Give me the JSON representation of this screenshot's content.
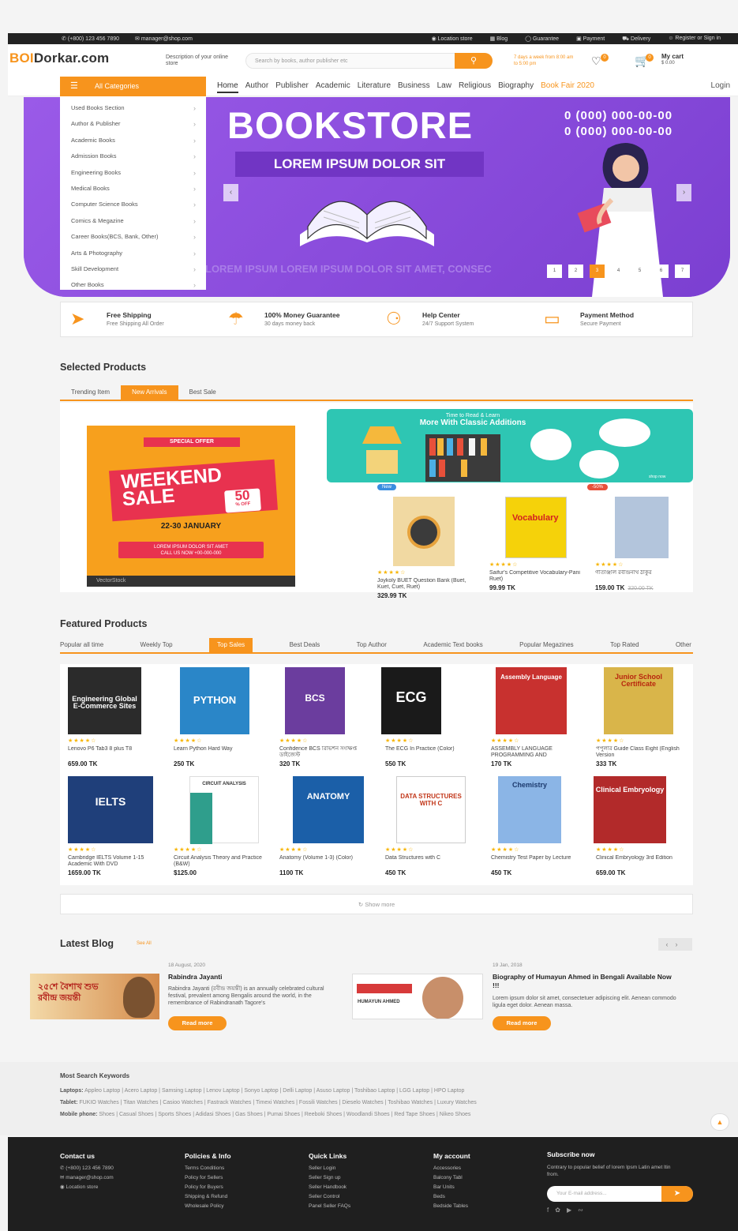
{
  "topbar": {
    "phone": "(+800) 123 456 7890",
    "email": "manager@shop.com",
    "links": [
      "Location store",
      "Blog",
      "Guarantee",
      "Payment",
      "Delivery",
      "Register or Sign in"
    ]
  },
  "header": {
    "logo_a": "BOI",
    "logo_b": "Dorkar.com",
    "desc": "Description of your online store",
    "search_placeholder": "Search by books, author publisher etc",
    "hours": "7 days a week from 8:00 am to 5:00 pm",
    "wish_count": "0",
    "cart_count": "0",
    "cart_label": "My cart",
    "cart_value": "$ 0.00"
  },
  "nav": {
    "all_categories": "All Categories",
    "menu": [
      "Home",
      "Author",
      "Publisher",
      "Academic",
      "Literature",
      "Business",
      "Law",
      "Religious",
      "Biography",
      "Book Fair 2020"
    ],
    "login": "Login"
  },
  "categories": [
    "Used Books Section",
    "Author & Publisher",
    "Academic Books",
    "Admission Books",
    "Engineering Books",
    "Medical Books",
    "Computer Science Books",
    "Comics & Megazine",
    "Career Books(BCS, Bank, Other)",
    "Arts & Photography",
    "Skill Development",
    "Other Books"
  ],
  "banner": {
    "title": "BOOKSTORE",
    "subtitle": "LOREM IPSUM DOLOR SIT",
    "phone1": "0 (000) 000-00-00",
    "phone2": "0 (000) 000-00-00",
    "bottom": "LOREM IPSUM LOREM IPSUM DOLOR SIT AMET, CONSEC",
    "pages": [
      "1",
      "2",
      "3",
      "4",
      "5",
      "6",
      "7"
    ],
    "active_page": "3"
  },
  "features": [
    {
      "title": "Free Shipping",
      "sub": "Free Shipping All Order",
      "icon": "rocket-icon"
    },
    {
      "title": "100% Money Guarantee",
      "sub": "30 days money back",
      "icon": "umbrella-icon"
    },
    {
      "title": "Help Center",
      "sub": "24/7 Support System",
      "icon": "support-24-icon"
    },
    {
      "title": "Payment Method",
      "sub": "Secure Payment",
      "icon": "card-icon"
    }
  ],
  "selected": {
    "heading": "Selected Products",
    "tabs": [
      "Trending Item",
      "New Arrivals",
      "Best Sale"
    ],
    "active_tab": "New Arrivals",
    "weekend": {
      "special": "SPECIAL OFFER",
      "l1": "WEEKEND",
      "l2": "SALE",
      "pct": "50",
      "off": "% OFF",
      "date": "22-30 JANUARY",
      "call1": "LOREM IPSUM DOLOR SIT AMET",
      "call2": "CALL US NOW +00-000-000",
      "foot": "VectorStock"
    },
    "classic": {
      "l1": "Time to Read & Learn",
      "l2": "More With Classic Additions",
      "more": "shop now"
    },
    "products": [
      {
        "tag": "New",
        "title": "Joykoly BUET Question Bank (Buet, Kuet, Cuet, Ruet)",
        "price": "329.99 TK",
        "old": ""
      },
      {
        "tag": "",
        "title": "Saifur's Competitive Vocabulary-Pani Ruet)",
        "price": "99.99 TK",
        "old": ""
      },
      {
        "tag": "-50%",
        "title": "গীতাঞ্জলি রবীন্দ্রনাথ ঠাকুর",
        "price": "159.00 TK",
        "old": "320.00 TK"
      }
    ]
  },
  "featured": {
    "heading": "Featured Products",
    "tabs": [
      "Popular all time",
      "Weekly Top",
      "Top Sales",
      "Best Deals",
      "Top Author",
      "Academic Text books",
      "Popular Megazines",
      "Top Rated",
      "Other"
    ],
    "active_tab": "Top Sales",
    "products": [
      {
        "title": "Lenovo P6 Tab3 8 plus T8",
        "price": "659.00 TK",
        "cover": "Engineering Global E-Commerce Sites",
        "color": "#2b2b2b"
      },
      {
        "title": "Learn Python Hard Way",
        "price": "250 TK",
        "cover": "PYTHON",
        "color": "#2a86c8"
      },
      {
        "title": "Confidence BCS রিভিশন সংক্ষিপ্ত ডাইজেস্ট",
        "price": "320 TK",
        "cover": "BCS",
        "color": "#6b3d9e"
      },
      {
        "title": "The ECG In Practice (Color)",
        "price": "550 TK",
        "cover": "ECG",
        "color": "#1a1a1a"
      },
      {
        "title": "ASSEMBLY LANGUAGE PROGRAMMING AND",
        "price": "170 TK",
        "cover": "Assembly Language",
        "color": "#c8312f"
      },
      {
        "title": "পপুলার Guide Class Eight (English Version",
        "price": "333 TK",
        "cover": "Junior School Certificate",
        "color": "#d9b54a"
      },
      {
        "title": "Cambridge IELTS Volume 1-15 Academic With DVD",
        "price": "1659.00 TK",
        "cover": "IELTS",
        "color": "#1f3f7a"
      },
      {
        "title": "Circuit Analysis Theory and Practice (B&W)",
        "price": "$125.00",
        "cover": "CIRCUIT ANALYSIS",
        "color": "#2f9e8c"
      },
      {
        "title": "Anatomy (Volume 1-3) (Color)",
        "price": "1100 TK",
        "cover": "ANATOMY",
        "color": "#1b5fa8"
      },
      {
        "title": "Data Structures with C",
        "price": "450 TK",
        "cover": "DATA STRUCTURES WITH C",
        "color": "#e26a2c"
      },
      {
        "title": "Chemistry Test Paper by Lecture",
        "price": "450 TK",
        "cover": "Chemistry",
        "color": "#8bb5e6"
      },
      {
        "title": "Clinical Embryology 3rd Edition",
        "price": "659.00 TK",
        "cover": "Clinical Embryology",
        "color": "#b22a2a"
      }
    ],
    "show_more": "Show more"
  },
  "blog": {
    "heading": "Latest Blog",
    "see_all": "See All",
    "posts": [
      {
        "date": "18 August, 2020",
        "title": "Rabindra Jayanti",
        "text": "Rabindra Jayanti (রবীন্দ্র জয়ন্তী) is an annually celebrated cultural festival, prevalent among Bengalis around the world, in the remembrance of Rabindranath Tagore's",
        "btn": "Read more",
        "img_text": "২৫শে বৈশাখ শুভ রবীন্দ্র জয়ন্তী"
      },
      {
        "date": "19 Jan, 2018",
        "title": "Biography of Humayun Ahmed in Bengali Available Now !!!",
        "text": "Lorem ipsum dolor sit amet, consectetuer adipiscing elit. Aenean commodo ligula eget dolor. Aenean massa.",
        "btn": "Read more",
        "img_text": "HUMAYUN AHMED"
      }
    ]
  },
  "keywords": {
    "heading": "Most Search Keywords",
    "rows": [
      {
        "label": "Laptops:",
        "items": "Appleo Laptop | Acero Laptop | Samsing Laptop | Lenov Laptop | Sonyo Laptop | Delli Laptop | Asuso Laptop | Toshibao Laptop | LGG Laptop | HPO Laptop"
      },
      {
        "label": "Tablet:",
        "items": "FUKIO Watches | Titan Watches | Casioo Watches | Fastrack Watches | Timexi Watches | Fossili Watches | Dieselo Watches | Toshibao Watches | Luxury Watches"
      },
      {
        "label": "Mobile phone:",
        "items": "Shoes | Casual Shoes | Sports Shoes | Adidasi Shoes | Gas Shoes | Pumai Shoes | Reeboki Shoes | Woodlandi Shoes | Red Tape Shoes | Nikeo Shoes"
      }
    ]
  },
  "footer": {
    "contact": {
      "title": "Contact us",
      "phone": "(+800) 123 456 7890",
      "email": "manager@shop.com",
      "loc": "Location store"
    },
    "policies": {
      "title": "Policies & Info",
      "items": [
        "Terms Conditions",
        "Policy for Sellers",
        "Policy for Buyers",
        "Shipping & Refund",
        "Wholesale Policy"
      ]
    },
    "quick": {
      "title": "Quick Links",
      "items": [
        "Seller Login",
        "Seller Sign up",
        "Seller Handbook",
        "Seller Control",
        "Panel Seller FAQs"
      ]
    },
    "account": {
      "title": "My account",
      "items": [
        "Accessories",
        "Balcony Tabl",
        "Bar Units",
        "Beds",
        "Bedside Tables"
      ]
    },
    "subscribe": {
      "title": "Subscribe now",
      "text": "Contrary to popular belief of lorem Ipsm Latin amet ltin from.",
      "placeholder": "Your E-mail address..."
    }
  }
}
